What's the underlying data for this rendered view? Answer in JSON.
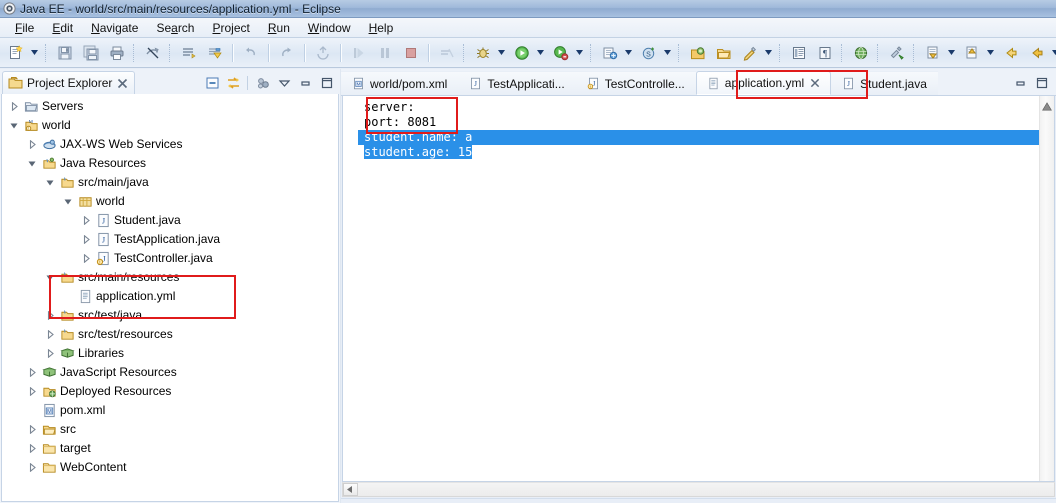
{
  "window": {
    "title": "Java EE - world/src/main/resources/application.yml - Eclipse",
    "icon": "eclipse-icon"
  },
  "menubar": {
    "items": [
      {
        "label": "File",
        "mnemonic": "F"
      },
      {
        "label": "Edit",
        "mnemonic": "E"
      },
      {
        "label": "Navigate",
        "mnemonic": "N"
      },
      {
        "label": "Search",
        "mnemonic": "a"
      },
      {
        "label": "Project",
        "mnemonic": "P"
      },
      {
        "label": "Run",
        "mnemonic": "R"
      },
      {
        "label": "Window",
        "mnemonic": "W"
      },
      {
        "label": "Help",
        "mnemonic": "H"
      }
    ]
  },
  "toolbar": {
    "groups": [
      {
        "icons": [
          "new-wizard-icon",
          "dropdown-arrow"
        ]
      },
      {
        "icons": [
          "save-icon",
          "save-all-icon",
          "print-icon"
        ]
      },
      {
        "icons": [
          "hide-annotations-icon"
        ]
      },
      {
        "icons": [
          "build-all-icon",
          "publish-icon"
        ]
      },
      {
        "icons": [
          "undo-icon"
        ]
      },
      {
        "icons": [
          "redo-icon"
        ]
      },
      {
        "icons": [
          "refresh-icon"
        ]
      },
      {
        "icons": [
          "resume-icon",
          "suspend-icon",
          "terminate-icon"
        ]
      },
      {
        "icons": [
          "skip-breakpoints-icon"
        ]
      },
      {
        "icons": [
          "debug-icon",
          "dropdown-arrow"
        ]
      },
      {
        "icons": [
          "run-icon",
          "dropdown-arrow"
        ]
      },
      {
        "icons": [
          "run-coverage-icon",
          "dropdown-arrow"
        ]
      },
      {
        "icons": [
          "external-tools-icon",
          "dropdown-arrow"
        ]
      },
      {
        "icons": [
          "new-server-icon",
          "dropdown-arrow"
        ]
      },
      {
        "icons": [
          "open-type-icon",
          "open-task-icon",
          "search-icon",
          "dropdown-arrow"
        ]
      },
      {
        "icons": [
          "toggle-breadcrumb-icon",
          "toggle-mark-occurrences-icon"
        ]
      },
      {
        "icons": [
          "open-web-browser-icon"
        ]
      },
      {
        "icons": [
          "run-last-tool-icon"
        ]
      },
      {
        "icons": [
          "next-annotation-icon",
          "dropdown-arrow",
          "previous-annotation-icon",
          "dropdown-arrow"
        ]
      },
      {
        "icons": [
          "back-icon",
          "back-history-icon",
          "dropdown-arrow",
          "forward-icon",
          "dropdown-arrow"
        ]
      },
      {
        "icons": [
          "new-java-project-icon"
        ]
      }
    ]
  },
  "project_explorer": {
    "tab_label": "Project Explorer",
    "tab_icon": "project-explorer-icon",
    "close_icon": "close-icon",
    "tools": [
      {
        "name": "collapse-all-icon"
      },
      {
        "name": "link-with-editor-icon"
      },
      {
        "name": "view-menu-focus-icon"
      },
      {
        "name": "view-menu-icon"
      },
      {
        "name": "minimize-icon"
      },
      {
        "name": "maximize-icon"
      }
    ],
    "tree": [
      {
        "label": "Servers",
        "depth": 1,
        "twisty": "collapsed",
        "icon": "servers-folder-icon"
      },
      {
        "label": "world",
        "depth": 1,
        "twisty": "expanded",
        "icon": "maven-project-icon"
      },
      {
        "label": "JAX-WS Web Services",
        "depth": 2,
        "twisty": "collapsed",
        "icon": "jaxws-icon"
      },
      {
        "label": "Java Resources",
        "depth": 2,
        "twisty": "expanded",
        "icon": "java-resources-icon"
      },
      {
        "label": "src/main/java",
        "depth": 3,
        "twisty": "expanded",
        "icon": "source-folder-icon"
      },
      {
        "label": "world",
        "depth": 4,
        "twisty": "expanded",
        "icon": "package-icon"
      },
      {
        "label": "Student.java",
        "depth": 5,
        "twisty": "collapsed",
        "icon": "java-file-icon"
      },
      {
        "label": "TestApplication.java",
        "depth": 5,
        "twisty": "collapsed",
        "icon": "java-file-icon"
      },
      {
        "label": "TestController.java",
        "depth": 5,
        "twisty": "collapsed",
        "icon": "java-file-warning-icon"
      },
      {
        "label": "src/main/resources",
        "depth": 3,
        "twisty": "expanded",
        "icon": "source-folder-icon"
      },
      {
        "label": "application.yml",
        "depth": 4,
        "twisty": "none",
        "icon": "yml-file-icon"
      },
      {
        "label": "src/test/java",
        "depth": 3,
        "twisty": "collapsed",
        "icon": "source-folder-icon"
      },
      {
        "label": "src/test/resources",
        "depth": 3,
        "twisty": "collapsed",
        "icon": "source-folder-icon"
      },
      {
        "label": "Libraries",
        "depth": 3,
        "twisty": "collapsed",
        "icon": "libraries-icon"
      },
      {
        "label": "JavaScript Resources",
        "depth": 2,
        "twisty": "collapsed",
        "icon": "libraries-icon"
      },
      {
        "label": "Deployed Resources",
        "depth": 2,
        "twisty": "collapsed",
        "icon": "deployed-resources-icon"
      },
      {
        "label": "pom.xml",
        "depth": 2,
        "twisty": "none",
        "icon": "maven-file-icon"
      },
      {
        "label": "src",
        "depth": 2,
        "twisty": "collapsed",
        "icon": "folder-open-icon"
      },
      {
        "label": "target",
        "depth": 2,
        "twisty": "collapsed",
        "icon": "folder-icon"
      },
      {
        "label": "WebContent",
        "depth": 2,
        "twisty": "collapsed",
        "icon": "folder-icon"
      }
    ]
  },
  "editor": {
    "tabs": [
      {
        "label": "world/pom.xml",
        "icon": "maven-file-icon",
        "active": false,
        "closeable": false
      },
      {
        "label": "TestApplicati...",
        "icon": "java-file-icon",
        "active": false,
        "closeable": false
      },
      {
        "label": "TestControlle...",
        "icon": "java-file-warning-icon",
        "active": false,
        "closeable": false
      },
      {
        "label": "application.yml",
        "icon": "yml-file-icon",
        "active": true,
        "closeable": true
      },
      {
        "label": "Student.java",
        "icon": "java-file-icon",
        "active": false,
        "closeable": false
      }
    ],
    "tools": [
      {
        "name": "minimize-icon"
      },
      {
        "name": "maximize-icon"
      }
    ],
    "filename": "application.yml",
    "lines": [
      {
        "text": "server:",
        "selected": "none"
      },
      {
        "text": "port: 8081",
        "selected": "none"
      },
      {
        "text": "student.name: a",
        "selected": "full"
      },
      {
        "text": "student.age: 15",
        "selected": "text"
      }
    ],
    "overview_ruler_marker": "warning-marker-icon",
    "hscroll_left_arrow": "scroll-left-arrow-icon"
  },
  "annotations": {
    "color": "#e01b1b",
    "boxes": [
      {
        "name": "highlight-resources-folder"
      },
      {
        "name": "highlight-active-tab"
      },
      {
        "name": "highlight-server-port"
      }
    ]
  }
}
